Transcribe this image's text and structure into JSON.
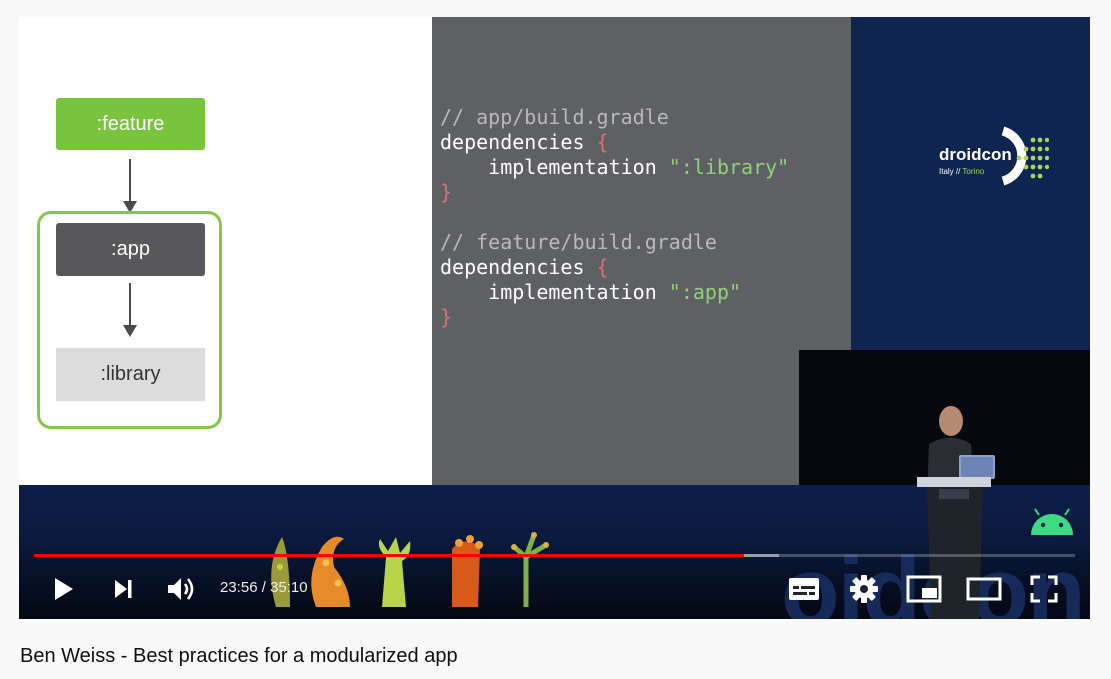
{
  "slide": {
    "boxes": {
      "feature": ":feature",
      "app": ":app",
      "library": ":library"
    },
    "code": {
      "line1_comment": "// app/build.gradle",
      "line2_keyword": "dependencies ",
      "line2_brace": "{",
      "line3_call": "    implementation ",
      "line3_string": "\":library\"",
      "line4_brace": "}",
      "line6_comment": "// feature/build.gradle",
      "line7_keyword": "dependencies ",
      "line7_brace": "{",
      "line8_call": "    implementation ",
      "line8_string": "\":app\"",
      "line9_brace": "}"
    },
    "colors": {
      "feature": "#78c43c",
      "app": "#58585a",
      "library": "#dcdcdc",
      "outline": "#82c84a"
    }
  },
  "brand": {
    "logo_text": "droidcon",
    "logo_sub_left": "Italy // ",
    "logo_sub_right": "Torino",
    "watermark": "oidcon"
  },
  "player": {
    "progress_played": 0.682,
    "progress_buffered": 0.716,
    "time_current": "23:56",
    "time_separator": " / ",
    "time_total": "35:10",
    "icons": {
      "play": "play-icon",
      "next": "next-icon",
      "volume": "volume-icon",
      "subtitles": "subtitles-icon",
      "settings": "gear-icon",
      "miniplayer": "miniplayer-icon",
      "theater": "theater-icon",
      "fullscreen": "fullscreen-icon"
    },
    "accent": "#ff0000"
  },
  "video": {
    "title": "Ben Weiss - Best practices for a modularized app"
  }
}
